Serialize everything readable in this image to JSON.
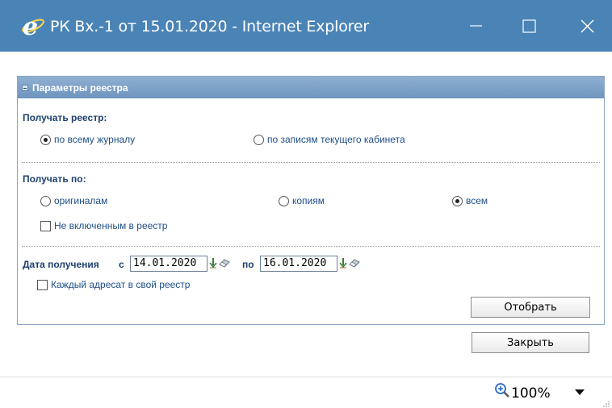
{
  "window": {
    "title": "РК Вх.-1 от 15.01.2020 - Internet Explorer",
    "titlebar_color": "#4a84b6"
  },
  "panel": {
    "title": "Параметры реестра",
    "header_color": "#7a9fc6",
    "get_registry": {
      "label": "Получать реестр:",
      "options": [
        "по всему журналу",
        "по записям текущего кабинета"
      ],
      "selected": "по всему журналу"
    },
    "get_by": {
      "label": "Получать по:",
      "options": [
        "оригиналам",
        "копиям",
        "всем"
      ],
      "selected": "всем",
      "not_included_label": "Не включенным в реестр",
      "not_included_checked": false
    },
    "date": {
      "label": "Дата получения",
      "from_label": "с",
      "from_value": "14.01.2020",
      "to_label": "по",
      "to_value": "16.01.2020"
    },
    "each_addressee_label": "Каждый адресат в свой реестр",
    "each_addressee_checked": false,
    "select_button": "Отобрать"
  },
  "close_button": "Закрыть",
  "statusbar": {
    "zoom": "100%"
  },
  "icons": {
    "ie_logo": "ie-logo-icon",
    "minimize": "minimize-icon",
    "maximize": "maximize-icon",
    "close": "close-icon",
    "calendar": "calendar-down-icon",
    "eraser": "eraser-icon",
    "zoom": "zoom-in-icon"
  }
}
